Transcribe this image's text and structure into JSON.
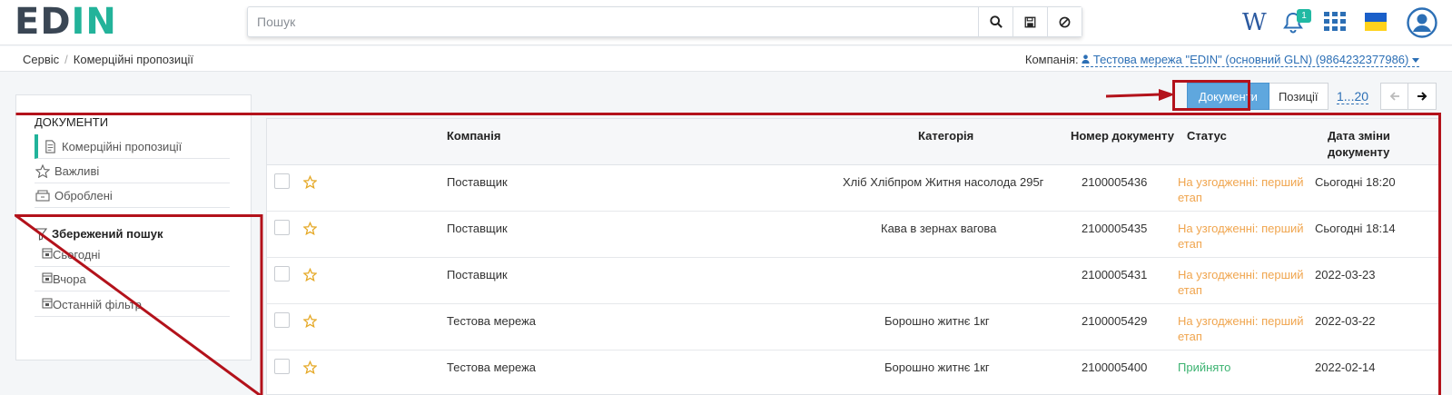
{
  "header": {
    "logo_part1": "ED",
    "logo_part2": "N",
    "logo_mid": "I",
    "search_placeholder": "Пошук",
    "wiki_label": "W",
    "notifications_count": "1",
    "icons": [
      "search-icon",
      "save-icon",
      "clear-icon",
      "wiki-icon",
      "bell-icon",
      "apps-icon",
      "flag-icon",
      "user-icon"
    ]
  },
  "breadcrumb": {
    "items": [
      "Сервіс",
      "Комерційні пропозиції"
    ],
    "separator": "/"
  },
  "company": {
    "label": "Компанія:",
    "value": "Тестова мережа \"EDIN\" (основний GLN) (9864232377986)"
  },
  "sidebar": {
    "title": "ДОКУМЕНТИ",
    "items": [
      {
        "label": "Комерційні пропозиції",
        "icon": "document-icon",
        "active": true
      },
      {
        "label": "Важливі",
        "icon": "star-icon",
        "active": false
      },
      {
        "label": "Оброблені",
        "icon": "archive-icon",
        "active": false
      }
    ],
    "saved_search_title": "Збережений пошук",
    "saved_search_items": [
      {
        "label": "Сьогодні",
        "icon": "calendar-icon"
      },
      {
        "label": "Вчора",
        "icon": "calendar-icon"
      },
      {
        "label": "Останній фільтр",
        "icon": "calendar-icon"
      }
    ]
  },
  "controls": {
    "documents_button": "Документи",
    "positions_button": "Позиції",
    "page_range": "1...20"
  },
  "table": {
    "columns": [
      "Компанія",
      "Категорія",
      "Номер документу",
      "Статус",
      "Дата зміни документу"
    ],
    "date_col_line1": "Дата зміни",
    "date_col_line2": "документу",
    "rows": [
      {
        "company": "Поставщик",
        "category": "Хліб Хлібпром Житня насолода 295г",
        "number": "2100005436",
        "status_line1": "На узгодженні: перший",
        "status_line2": "етап",
        "status_color": "#f0a54e",
        "date": "Сьогодні 18:20"
      },
      {
        "company": "Поставщик",
        "category": "Кава в зернах вагова",
        "number": "2100005435",
        "status_line1": "На узгодженні: перший",
        "status_line2": "етап",
        "status_color": "#f0a54e",
        "date": "Сьогодні 18:14"
      },
      {
        "company": "Поставщик",
        "category": "",
        "number": "2100005431",
        "status_line1": "На узгодженні: перший",
        "status_line2": "етап",
        "status_color": "#f0a54e",
        "date": "2022-03-23"
      },
      {
        "company": "Тестова мережа",
        "category": "Борошно житнє 1кг",
        "number": "2100005429",
        "status_line1": "На узгодженні: перший",
        "status_line2": "етап",
        "status_color": "#f0a54e",
        "date": "2022-03-22"
      },
      {
        "company": "Тестова мережа",
        "category": "Борошно житнє 1кг",
        "number": "2100005400",
        "status_line1": "Прийнято",
        "status_line2": "",
        "status_color": "#3cb371",
        "date": "2022-02-14"
      }
    ]
  },
  "colors": {
    "accent": "#21b39a",
    "primary_button": "#5fa7de",
    "link": "#2c6fb5",
    "annotation": "#b3121b"
  }
}
